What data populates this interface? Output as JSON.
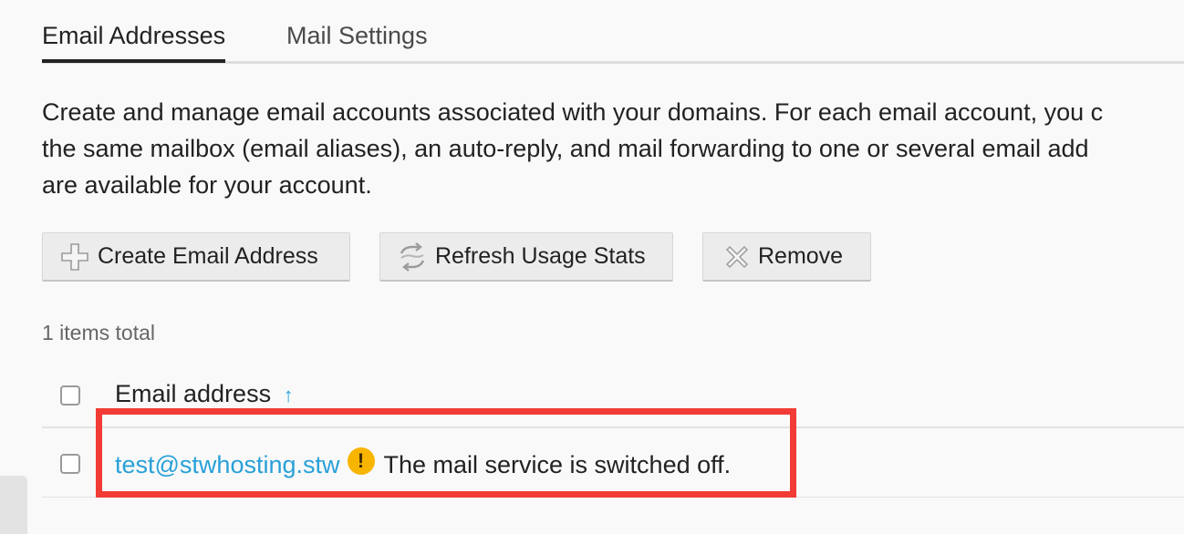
{
  "tabs": {
    "email_addresses": "Email Addresses",
    "mail_settings": "Mail Settings"
  },
  "description": {
    "line1": "Create and manage email accounts associated with your domains. For each email account, you c",
    "line2": "the same mailbox (email aliases), an auto-reply, and mail forwarding to one or several email add",
    "line3": "are available for your account."
  },
  "toolbar": {
    "create_label": "Create Email Address",
    "create_icon": "plus-icon",
    "refresh_label": "Refresh Usage Stats",
    "refresh_icon": "refresh-icon",
    "remove_label": "Remove",
    "remove_icon": "x-icon"
  },
  "list": {
    "total_text": "1 items total",
    "column_header": "Email address",
    "sort_indicator": "↑",
    "rows": [
      {
        "email": "test@stwhosting.stw",
        "warning_icon": "warning-icon",
        "warning_glyph": "!",
        "status": "The mail service is switched off."
      }
    ]
  },
  "colors": {
    "link": "#28a0d8",
    "warning": "#f7b500",
    "highlight": "#f23b35",
    "background": "#f9f9f9"
  }
}
